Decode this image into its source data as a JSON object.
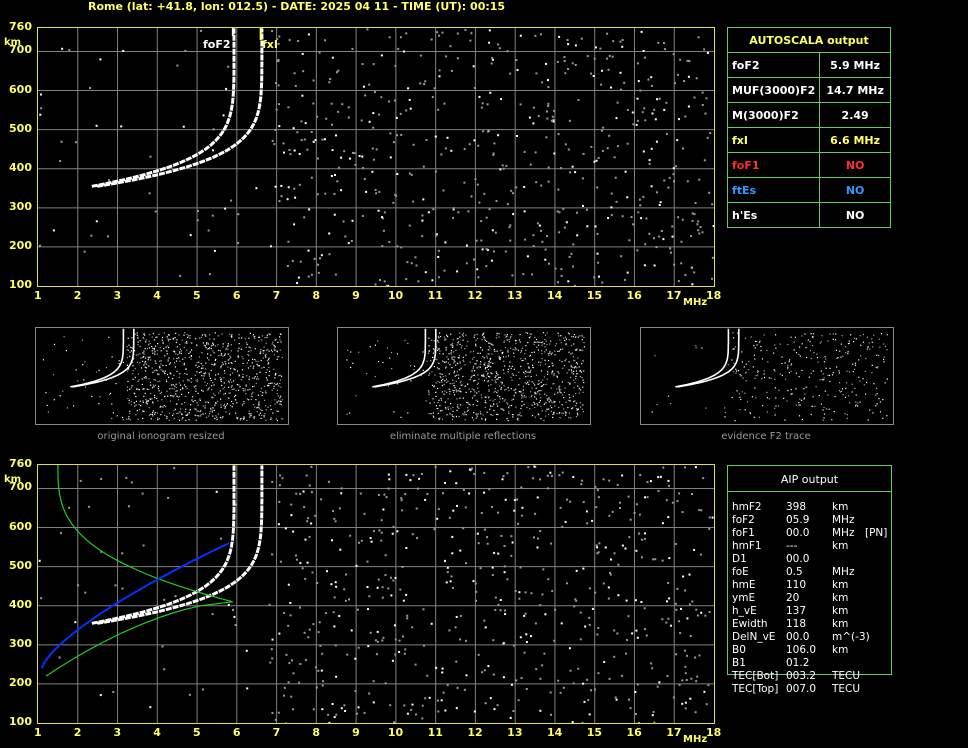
{
  "header": "Rome (lat: +41.8, lon: 012.5) - DATE: 2025 04 11 - TIME (UT): 00:15",
  "axis": {
    "y_ticks": [
      "760",
      "700",
      "600",
      "500",
      "400",
      "300",
      "200",
      "100"
    ],
    "y_unit": "km",
    "x_ticks": [
      "1",
      "2",
      "3",
      "4",
      "5",
      "6",
      "7",
      "8",
      "9",
      "10",
      "11",
      "12",
      "13",
      "14",
      "15",
      "16",
      "17",
      "18"
    ],
    "x_unit": "MHz"
  },
  "top_labels": {
    "fof2": "foF2",
    "fxi": "fxI"
  },
  "autoscala": {
    "title": "AUTOSCALA output",
    "rows": [
      {
        "key": "foF2",
        "value": "5.9 MHz",
        "key_color": "#ffffff",
        "value_color": "#ffffff"
      },
      {
        "key": "MUF(3000)F2",
        "value": "14.7 MHz",
        "key_color": "#ffffff",
        "value_color": "#ffffff"
      },
      {
        "key": "M(3000)F2",
        "value": "2.49",
        "key_color": "#ffffff",
        "value_color": "#ffffff"
      },
      {
        "key": "fxI",
        "value": "6.6 MHz",
        "key_color": "#ffff66",
        "value_color": "#ffff66"
      },
      {
        "key": "foF1",
        "value": "NO",
        "key_color": "#ff3030",
        "value_color": "#ff3030"
      },
      {
        "key": "ftEs",
        "value": "NO",
        "key_color": "#3399ff",
        "value_color": "#3399ff"
      },
      {
        "key": "h'Es",
        "value": "NO",
        "key_color": "#ffffff",
        "value_color": "#ffffff"
      }
    ]
  },
  "thumbnails": [
    {
      "caption": "original ionogram resized"
    },
    {
      "caption": "eliminate multiple reflections"
    },
    {
      "caption": "evidence F2 trace"
    }
  ],
  "aip": {
    "title": "AIP output",
    "rows": [
      {
        "k": "hmF2",
        "v": "398",
        "u": "km",
        "x": ""
      },
      {
        "k": "foF2",
        "v": "05.9",
        "u": "MHz",
        "x": ""
      },
      {
        "k": "foF1",
        "v": "00.0",
        "u": "MHz",
        "x": "[PN]"
      },
      {
        "k": "hmF1",
        "v": "---",
        "u": "km",
        "x": ""
      },
      {
        "k": "D1",
        "v": "00.0",
        "u": "",
        "x": ""
      },
      {
        "k": "foE",
        "v": "0.5",
        "u": "MHz",
        "x": ""
      },
      {
        "k": "hmE",
        "v": "110",
        "u": "km",
        "x": ""
      },
      {
        "k": "ymE",
        "v": "20",
        "u": "km",
        "x": ""
      },
      {
        "k": "h_vE",
        "v": "137",
        "u": "km",
        "x": ""
      },
      {
        "k": "Ewidth",
        "v": "118",
        "u": "km",
        "x": ""
      },
      {
        "k": "DelN_vE",
        "v": "00.0",
        "u": "m^(-3)",
        "x": ""
      },
      {
        "k": "B0",
        "v": "106.0",
        "u": "km",
        "x": ""
      },
      {
        "k": "B1",
        "v": "01.2",
        "u": "",
        "x": ""
      },
      {
        "k": "TEC[Bot]",
        "v": "003.2",
        "u": "TECU",
        "x": ""
      },
      {
        "k": "TEC[Top]",
        "v": "007.0",
        "u": "TECU",
        "x": ""
      }
    ]
  },
  "colors": {
    "axis": "#e0e040",
    "grid": "#808080",
    "trace": "#ffffff",
    "fit": "#0033ff",
    "profile": "#22cc22"
  }
}
